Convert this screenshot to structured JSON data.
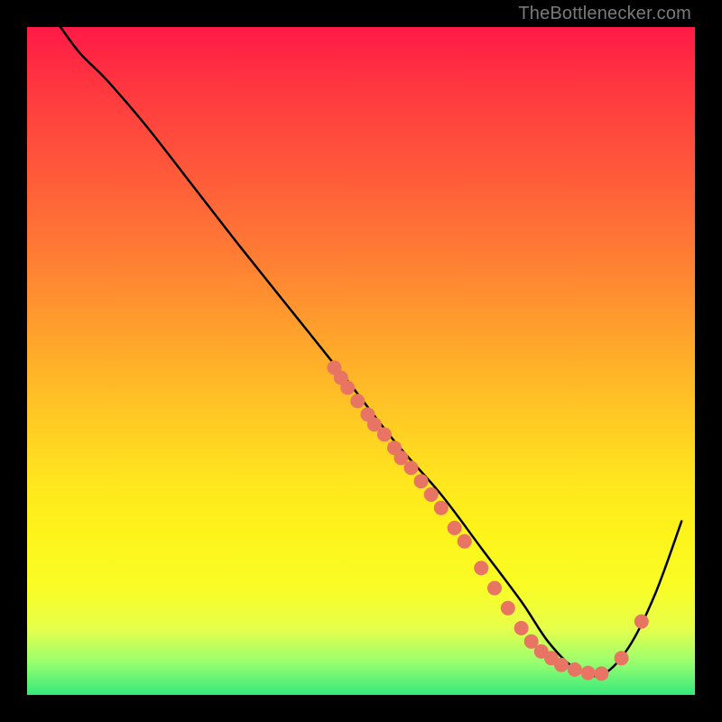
{
  "watermark": "TheBottlenecker.com",
  "chart_data": {
    "type": "line",
    "title": "",
    "xlabel": "",
    "ylabel": "",
    "xlim": [
      0,
      100
    ],
    "ylim": [
      0,
      100
    ],
    "series": [
      {
        "name": "bottleneck-curve",
        "x": [
          5,
          8,
          12,
          18,
          25,
          32,
          40,
          48,
          55,
          62,
          68,
          74,
          78,
          82,
          86,
          90,
          94,
          98
        ],
        "y": [
          100,
          96,
          92,
          85,
          76,
          67,
          57,
          47,
          38,
          30,
          22,
          14,
          8,
          4,
          3,
          7,
          15,
          26
        ]
      }
    ],
    "markers": [
      {
        "x": 46,
        "y": 49
      },
      {
        "x": 47,
        "y": 47.5
      },
      {
        "x": 48,
        "y": 46
      },
      {
        "x": 49.5,
        "y": 44
      },
      {
        "x": 51,
        "y": 42
      },
      {
        "x": 52,
        "y": 40.5
      },
      {
        "x": 53.5,
        "y": 39
      },
      {
        "x": 55,
        "y": 37
      },
      {
        "x": 56,
        "y": 35.5
      },
      {
        "x": 57.5,
        "y": 34
      },
      {
        "x": 59,
        "y": 32
      },
      {
        "x": 60.5,
        "y": 30
      },
      {
        "x": 62,
        "y": 28
      },
      {
        "x": 64,
        "y": 25
      },
      {
        "x": 65.5,
        "y": 23
      },
      {
        "x": 68,
        "y": 19
      },
      {
        "x": 70,
        "y": 16
      },
      {
        "x": 72,
        "y": 13
      },
      {
        "x": 74,
        "y": 10
      },
      {
        "x": 75.5,
        "y": 8
      },
      {
        "x": 77,
        "y": 6.5
      },
      {
        "x": 78.5,
        "y": 5.5
      },
      {
        "x": 80,
        "y": 4.5
      },
      {
        "x": 82,
        "y": 3.8
      },
      {
        "x": 84,
        "y": 3.3
      },
      {
        "x": 86,
        "y": 3.2
      },
      {
        "x": 89,
        "y": 5.5
      },
      {
        "x": 92,
        "y": 11
      }
    ],
    "marker_radius": 8,
    "colors": {
      "curve": "#000000",
      "marker": "#e87464",
      "gradient_top": "#ff1a47",
      "gradient_bottom": "#35e97b"
    }
  }
}
